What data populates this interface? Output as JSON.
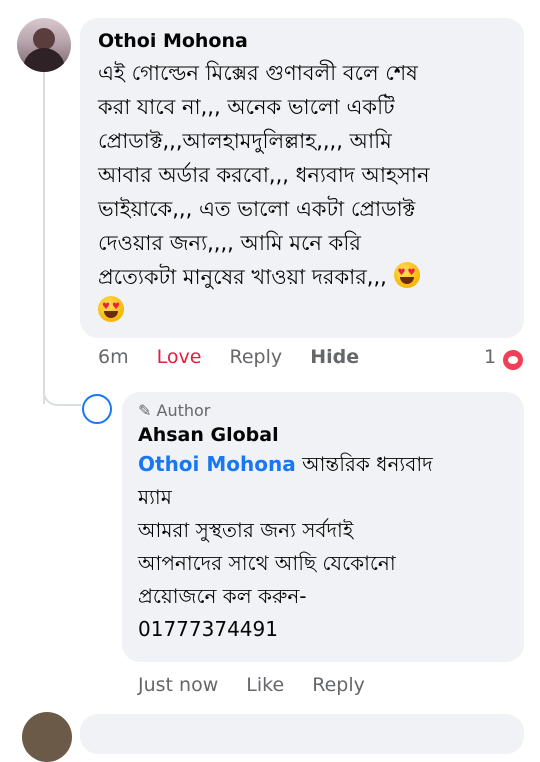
{
  "comment": {
    "author": "Othoi Mohona",
    "text": "এই গোল্ডেন মিক্সের গুণাবলী বলে শেষ\nকরা যাবে না,,, অনেক ভালো একটি\nপ্রোডাক্ট,,,আলহামদুলিল্লাহ,,,, আমি\nআবার অর্ডার করবো,,, ধন্যবাদ আহসান\nভাইয়াকে,,, এত ভালো একটা প্রোডাক্ট\nদেওয়ার জন্য,,,, আমি মনে করি\nপ্রত্যেকটা মানুষের খাওয়া দরকার,,,",
    "emoji": "heart-eyes",
    "time": "6m",
    "love_label": "Love",
    "reply_label": "Reply",
    "hide_label": "Hide",
    "reaction_count": "1"
  },
  "reply": {
    "badge": "Author",
    "author": "Ahsan Global",
    "mention": "Othoi Mohona",
    "text_first": " আন্তরিক ধন্যবাদ\nম্যাম\nআমরা সুস্থতার জন্য সর্বদাই\nআপনাদের সাথে আছি যেকোনো\nপ্রয়োজনে কল করুন-\n01777374491",
    "time": "Just now",
    "like_label": "Like",
    "reply_label": "Reply"
  }
}
